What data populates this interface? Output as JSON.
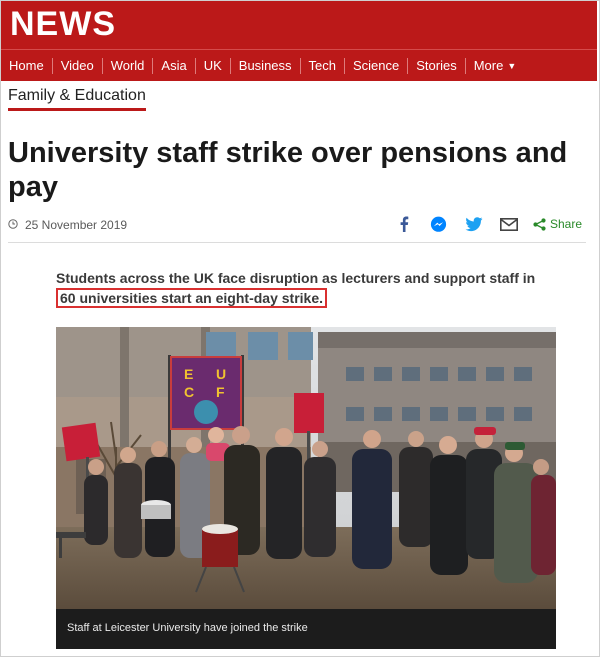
{
  "header": {
    "brand": "NEWS"
  },
  "nav": {
    "items": [
      "Home",
      "Video",
      "World",
      "Asia",
      "UK",
      "Business",
      "Tech",
      "Science",
      "Stories"
    ],
    "more_label": "More"
  },
  "article": {
    "section": "Family & Education",
    "headline": "University staff strike over pensions and pay",
    "date": "25 November 2019",
    "share_label": "Share",
    "intro_before": "Students across the UK face disruption as lecturers and support staff in ",
    "intro_highlight": "60 universities start an eight-day strike.",
    "photo_caption": "Staff at Leicester University have joined the strike",
    "banner_letters": [
      "E",
      "U",
      "C",
      "F"
    ]
  },
  "colors": {
    "brand_red": "#bb1919",
    "highlight": "#d93030",
    "share_green": "#2a8a2a"
  },
  "icons": [
    "clock-icon",
    "facebook-icon",
    "messenger-icon",
    "twitter-icon",
    "email-icon",
    "share-icon",
    "chevron-down-icon"
  ]
}
